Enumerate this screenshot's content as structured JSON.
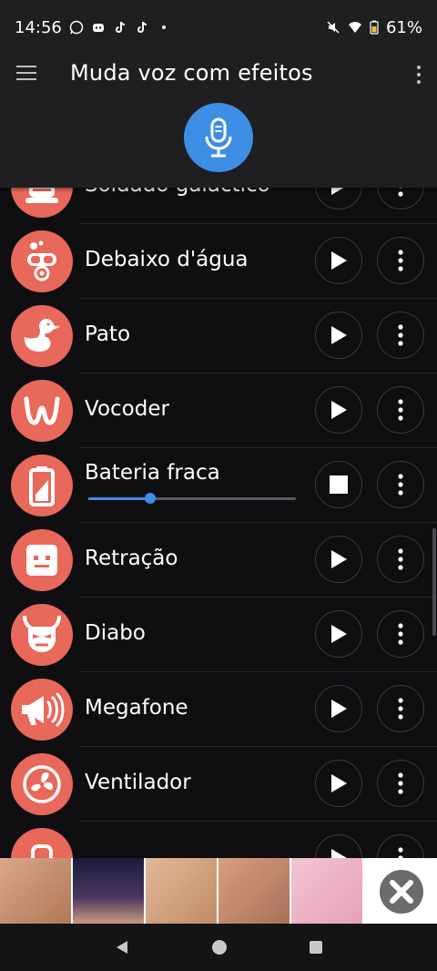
{
  "status_bar": {
    "time": "14:56",
    "battery": "61%",
    "left_icons": [
      "whatsapp-icon",
      "discord-icon",
      "tiktok-icon",
      "tiktok-icon",
      "dot-icon"
    ],
    "right_icons": [
      "mute-icon",
      "wifi-icon",
      "battery-icon"
    ]
  },
  "app_bar": {
    "title": "Muda voz com efeitos",
    "menu_icon": "hamburger-icon",
    "overflow_icon": "more-vert-icon",
    "mic_icon": "mic-icon"
  },
  "effects": [
    {
      "name": "Soldado galáctico",
      "icon": "robot-soldier-icon",
      "state": "stopped"
    },
    {
      "name": "Debaixo d'água",
      "icon": "diver-icon",
      "state": "stopped"
    },
    {
      "name": "Pato",
      "icon": "duck-icon",
      "state": "stopped"
    },
    {
      "name": "Vocoder",
      "icon": "vocoder-wave-icon",
      "state": "stopped"
    },
    {
      "name": "Bateria fraca",
      "icon": "low-battery-icon",
      "state": "playing",
      "progress": 0.3
    },
    {
      "name": "Retração",
      "icon": "robot-face-icon",
      "state": "stopped"
    },
    {
      "name": "Diabo",
      "icon": "devil-icon",
      "state": "stopped"
    },
    {
      "name": "Megafone",
      "icon": "megaphone-icon",
      "state": "stopped"
    },
    {
      "name": "Ventilador",
      "icon": "fan-icon",
      "state": "stopped"
    },
    {
      "name": "",
      "icon": "partial-icon",
      "state": "stopped"
    }
  ],
  "colors": {
    "accent": "#3f8ee6",
    "avatar": "#e8685a",
    "background": "#0f0f12",
    "bar": "#1f1f22"
  },
  "ad_banner": {
    "close_icon": "close-x-icon"
  },
  "nav_bar": {
    "icons": [
      "back-icon",
      "home-icon",
      "recents-icon"
    ]
  }
}
